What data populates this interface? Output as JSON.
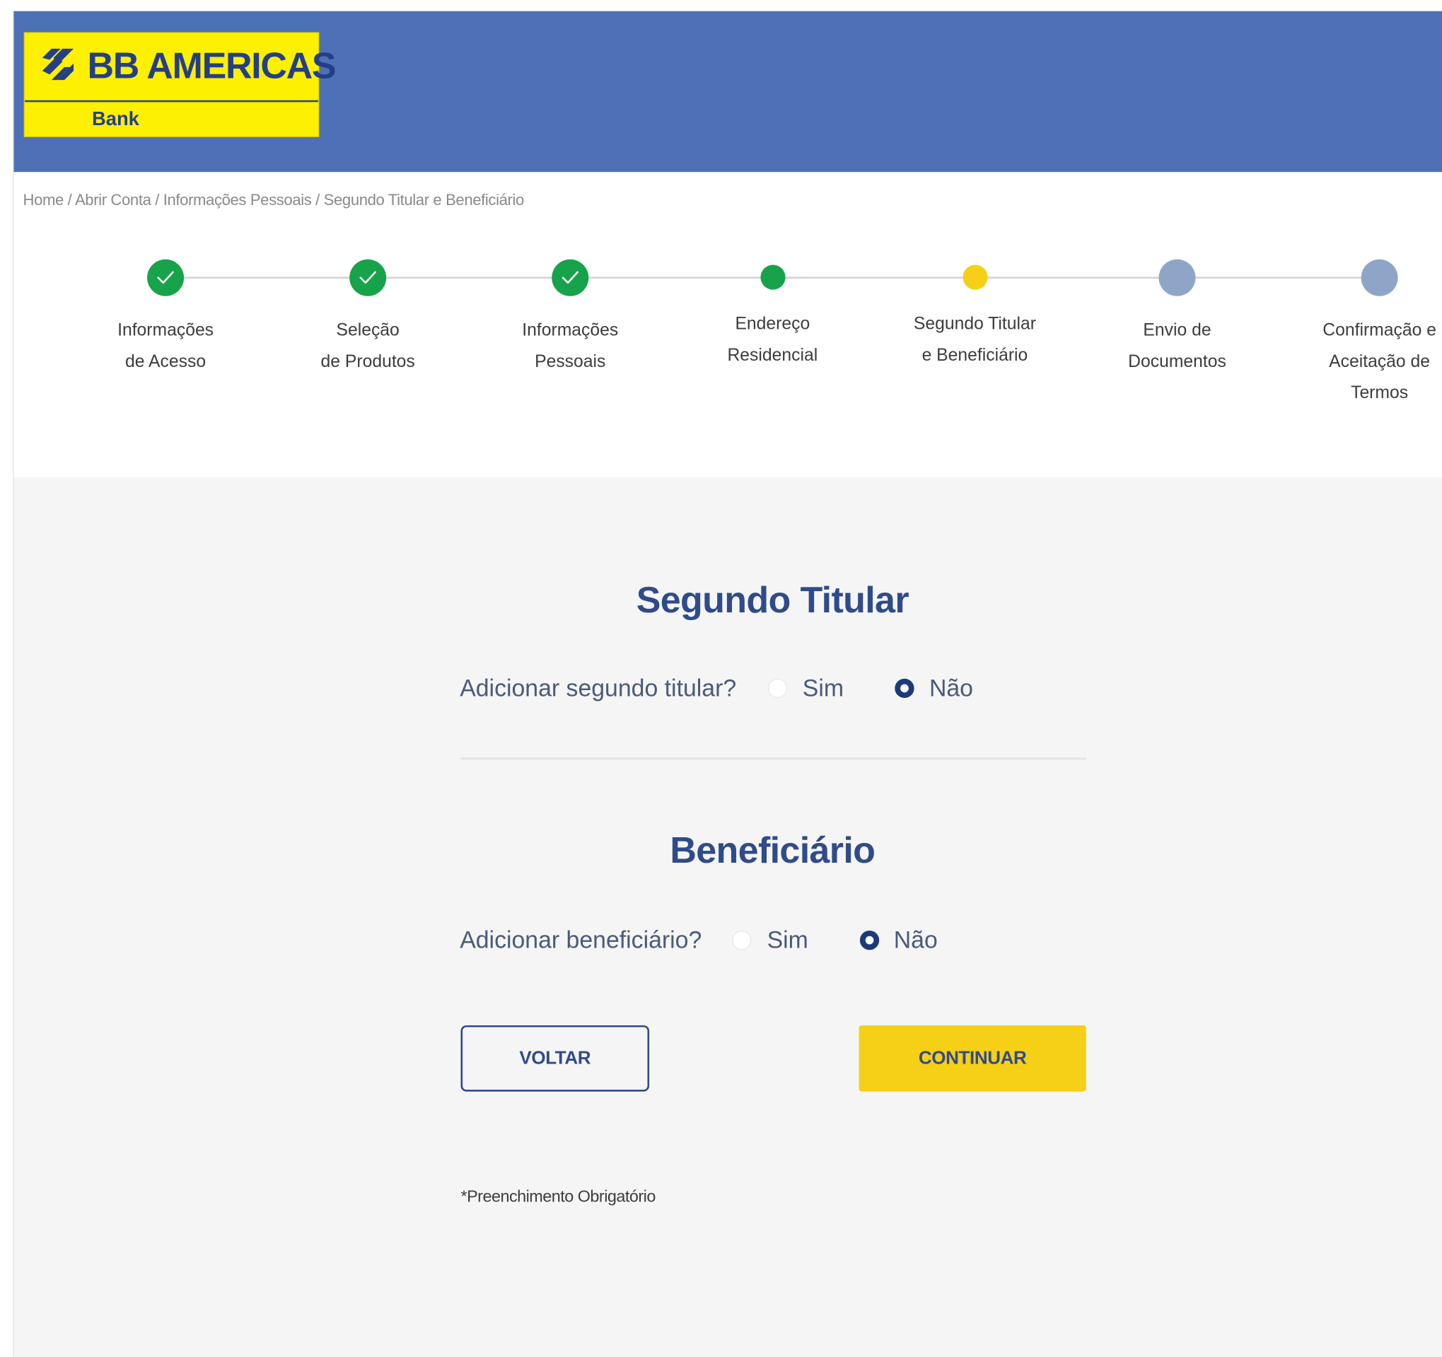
{
  "logo": {
    "name": "BB AMERICAS",
    "sub": "Bank"
  },
  "breadcrumb": "Home / Abrir Conta / Informações Pessoais / Segundo Titular e Beneficiário",
  "steps": [
    {
      "lines": [
        "Informações",
        "de Acesso"
      ],
      "status": "completed"
    },
    {
      "lines": [
        "Seleção",
        "de Produtos"
      ],
      "status": "completed"
    },
    {
      "lines": [
        "Informações",
        "Pessoais"
      ],
      "status": "completed"
    },
    {
      "lines": [
        "Endereço",
        "Residencial"
      ],
      "status": "done"
    },
    {
      "lines": [
        "Segundo Titular",
        "e Beneficiário"
      ],
      "status": "current"
    },
    {
      "lines": [
        "Envio de",
        "Documentos"
      ],
      "status": "pending"
    },
    {
      "lines": [
        "Confirmação e",
        "Aceitação de",
        "Termos"
      ],
      "status": "pending"
    }
  ],
  "colors": {
    "header": "#4e71b5",
    "logo_yellow": "#fdf000",
    "step_completed": "#16a34a",
    "step_current": "#f6cf17",
    "step_pending": "#8fa5c8",
    "title": "#2f4b8a",
    "button_primary": "#f6cf17"
  },
  "icons": {
    "logo": "bb-logo-icon",
    "check": "check-icon"
  },
  "second_holder": {
    "title": "Segundo Titular",
    "question": "Adicionar segundo titular?",
    "option_yes": "Sim",
    "option_no": "Não",
    "selected": "Não"
  },
  "beneficiary": {
    "title": "Beneficiário",
    "question": "Adicionar beneficiário?",
    "option_yes": "Sim",
    "option_no": "Não",
    "selected": "Não"
  },
  "buttons": {
    "back": "VOLTAR",
    "next": "CONTINUAR"
  },
  "required_note": "*Preenchimento Obrigatório"
}
